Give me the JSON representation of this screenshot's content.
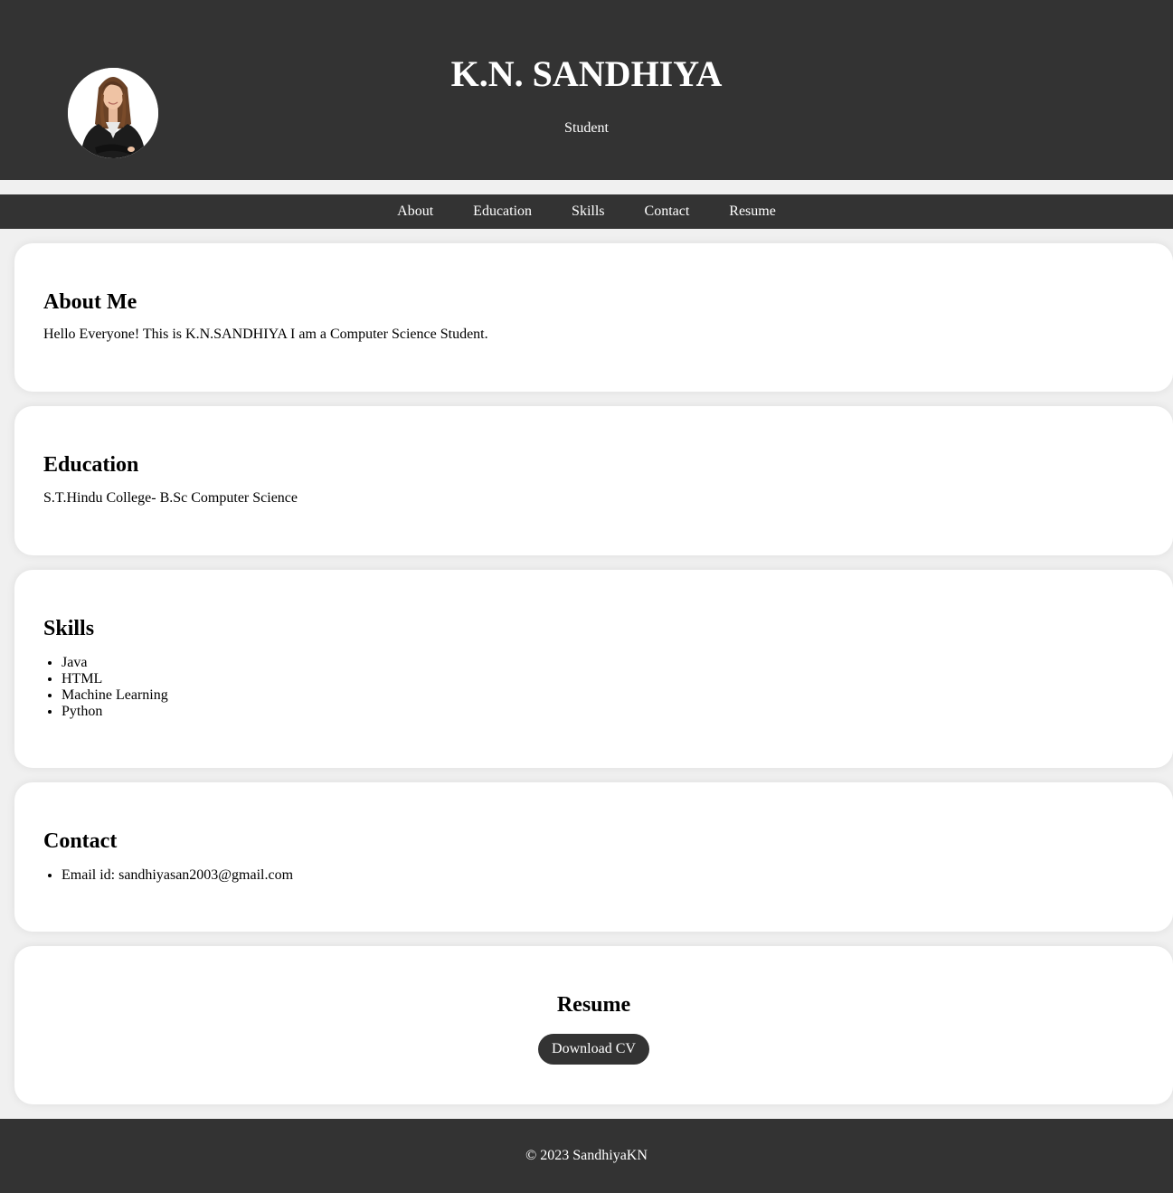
{
  "header": {
    "title": "K.N. SANDHIYA",
    "subtitle": "Student",
    "avatar_alt": "profile photo"
  },
  "nav": {
    "items": [
      {
        "label": "About"
      },
      {
        "label": "Education"
      },
      {
        "label": "Skills"
      },
      {
        "label": "Contact"
      },
      {
        "label": "Resume"
      }
    ]
  },
  "about": {
    "heading": "About Me",
    "text": "Hello Everyone! This is K.N.SANDHIYA I am a Computer Science Student."
  },
  "education": {
    "heading": "Education",
    "text": "S.T.Hindu College- B.Sc Computer Science"
  },
  "skills": {
    "heading": "Skills",
    "items": [
      "Java",
      "HTML",
      "Machine Learning",
      "Python"
    ]
  },
  "contact": {
    "heading": "Contact",
    "items": [
      "Email id: sandhiyasan2003@gmail.com"
    ]
  },
  "resume": {
    "heading": "Resume",
    "button_label": "Download CV"
  },
  "footer": {
    "text": "© 2023 SandhiyaKN"
  },
  "colors": {
    "dark": "#333333",
    "page_bg": "#f0f0f0",
    "card_bg": "#ffffff"
  }
}
